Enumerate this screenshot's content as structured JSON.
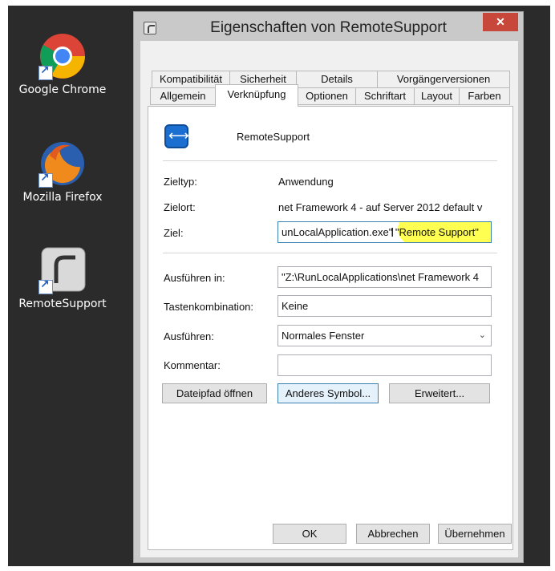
{
  "desktop": {
    "icons": [
      {
        "label": "Google Chrome",
        "icon": "chrome-icon"
      },
      {
        "label": "Mozilla Firefox",
        "icon": "firefox-icon"
      },
      {
        "label": "RemoteSupport",
        "icon": "remotesupport-icon"
      }
    ]
  },
  "window": {
    "title": "Eigenschaften von RemoteSupport",
    "close_label": "✕"
  },
  "tabs": {
    "row1": [
      "Kompatibilität",
      "Sicherheit",
      "Details",
      "Vorgängerversionen"
    ],
    "row2": [
      "Allgemein",
      "Verknüpfung",
      "Optionen",
      "Schriftart",
      "Layout",
      "Farben"
    ],
    "active": "Verknüpfung"
  },
  "shortcut": {
    "app_name": "RemoteSupport",
    "zieltyp_label": "Zieltyp:",
    "zieltyp_value": "Anwendung",
    "zielort_label": "Zielort:",
    "zielort_value": "net Framework 4 - auf Server 2012 default v",
    "ziel_label": "Ziel:",
    "ziel_value": "unLocalApplication.exe\" \"Remote Support\"",
    "ausfuehren_in_label": "Ausführen in:",
    "ausfuehren_in_value": "\"Z:\\RunLocalApplications\\net Framework 4",
    "tasten_label": "Tastenkombination:",
    "tasten_value": "Keine",
    "ausfuehren_label": "Ausführen:",
    "ausfuehren_value": "Normales Fenster",
    "kommentar_label": "Kommentar:",
    "kommentar_value": ""
  },
  "buttons": {
    "open_path": "Dateipfad öffnen",
    "change_icon": "Anderes Symbol...",
    "advanced": "Erweitert...",
    "ok": "OK",
    "cancel": "Abbrechen",
    "apply": "Übernehmen"
  },
  "colors": {
    "highlight": "#ffff00",
    "close": "#c7473a",
    "accent": "#3c7fb1"
  }
}
